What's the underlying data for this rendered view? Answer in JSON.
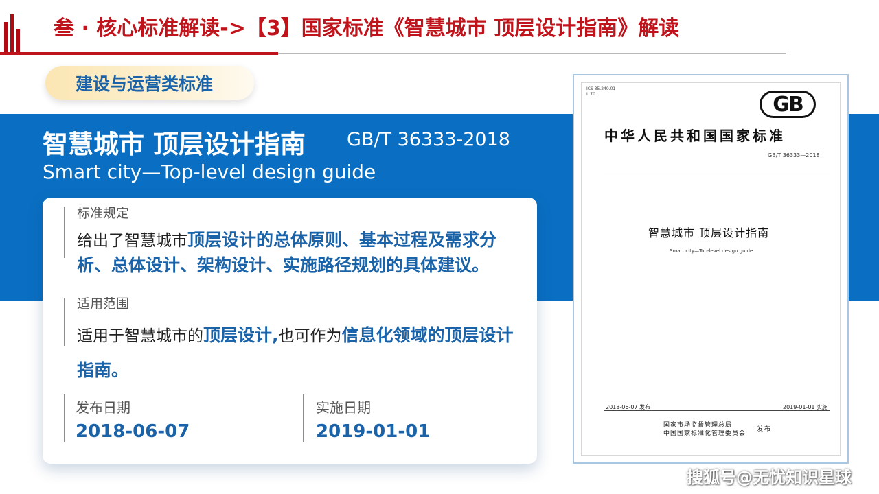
{
  "header": {
    "title": "叁 · 核心标准解读->【3】国家标准《智慧城市 顶层设计指南》解读",
    "brand_color": "#c0141c"
  },
  "category": {
    "label": "建设与运营类标准"
  },
  "standard": {
    "title_cn": "智慧城市 顶层设计指南",
    "code": "GB/T 36333-2018",
    "title_en": "Smart city—Top-level design guide"
  },
  "provision": {
    "label": "标准规定",
    "text_plain": "给出了智慧城市",
    "text_highlight": "顶层设计的总体原则、基本过程及需求分析、总体设计、架构设计、实施路径规划的具体建议。"
  },
  "scope": {
    "label": "适用范围",
    "text_plain_1": "适用于智慧城市的",
    "text_highlight_1": "顶层设计,",
    "text_plain_2": "也可作为",
    "text_highlight_2": "信息化领域的顶层设计指南。"
  },
  "dates": {
    "publish_label": "发布日期",
    "publish_value": "2018-06-07",
    "implement_label": "实施日期",
    "implement_value": "2019-01-01"
  },
  "document_image": {
    "ics": "ICS 35.240.01",
    "ccs": "L 70",
    "logo": "GB",
    "national_standard": "中华人民共和国国家标准",
    "code": "GB/T 36333—2018",
    "title_cn": "智慧城市  顶层设计指南",
    "title_en": "Smart city—Top-level design guide",
    "publish": "2018-06-07 发布",
    "implement": "2019-01-01 实施",
    "issuer_1": "国家市场监督管理总局",
    "issuer_2": "中国国家标准化管理委员会",
    "issue": "发布"
  },
  "watermark": {
    "text": "搜狐号@无忧知识星球"
  },
  "colors": {
    "accent_blue": "#1a63a8",
    "band_blue": "#0a6fc2"
  }
}
